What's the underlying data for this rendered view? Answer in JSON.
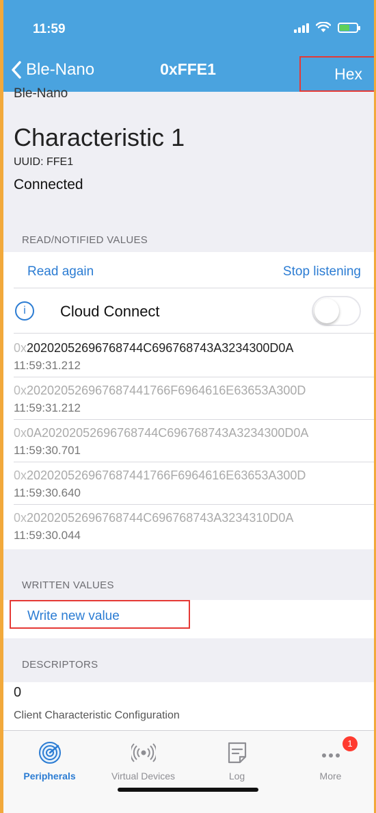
{
  "status_bar": {
    "time": "11:59"
  },
  "nav": {
    "back_label": "Ble-Nano",
    "title": "0xFFE1",
    "right_button": "Hex"
  },
  "characteristic": {
    "ghost_device": "Ble-Nano",
    "name": "Characteristic 1",
    "uuid": "UUID: FFE1",
    "state": "Connected"
  },
  "read_section": {
    "header": "READ/NOTIFIED VALUES",
    "read_again": "Read again",
    "stop_listening": "Stop listening",
    "cloud_connect": "Cloud Connect",
    "cloud_connect_on": false,
    "values": [
      {
        "prefix": "0x",
        "hex": "2020205269676874 4C6967687 43A3234300D0A",
        "time": "11:59:31.212"
      },
      {
        "prefix": "0x",
        "hex": "202020526967687441766F6964616E63653A300D",
        "time": "11:59:31.212"
      },
      {
        "prefix": "0x",
        "hex": "0A2020205269676874 4C6967687 43A3234300D0A",
        "time": "11:59:30.701"
      },
      {
        "prefix": "0x",
        "hex": "202020526967687441766F6964616E63653A300D",
        "time": "11:59:30.640"
      },
      {
        "prefix": "0x",
        "hex": "2020205269676874 4C6967687 43A3234310D0A",
        "time": "11:59:30.044"
      }
    ]
  },
  "written_section": {
    "header": "WRITTEN VALUES",
    "write_new": "Write new value"
  },
  "descriptors_section": {
    "header": "DESCRIPTORS",
    "items": [
      {
        "value": "0",
        "name": "Client Characteristic Configuration"
      }
    ]
  },
  "tabbar": {
    "tabs": [
      {
        "label": "Peripherals",
        "icon": "peripherals-icon",
        "active": true
      },
      {
        "label": "Virtual Devices",
        "icon": "virtual-devices-icon",
        "active": false
      },
      {
        "label": "Log",
        "icon": "log-icon",
        "active": false
      },
      {
        "label": "More",
        "icon": "more-icon",
        "active": false,
        "badge": "1"
      }
    ]
  },
  "colors": {
    "accent": "#4aa3df",
    "link": "#2b7cd3",
    "highlight": "#e53935"
  }
}
